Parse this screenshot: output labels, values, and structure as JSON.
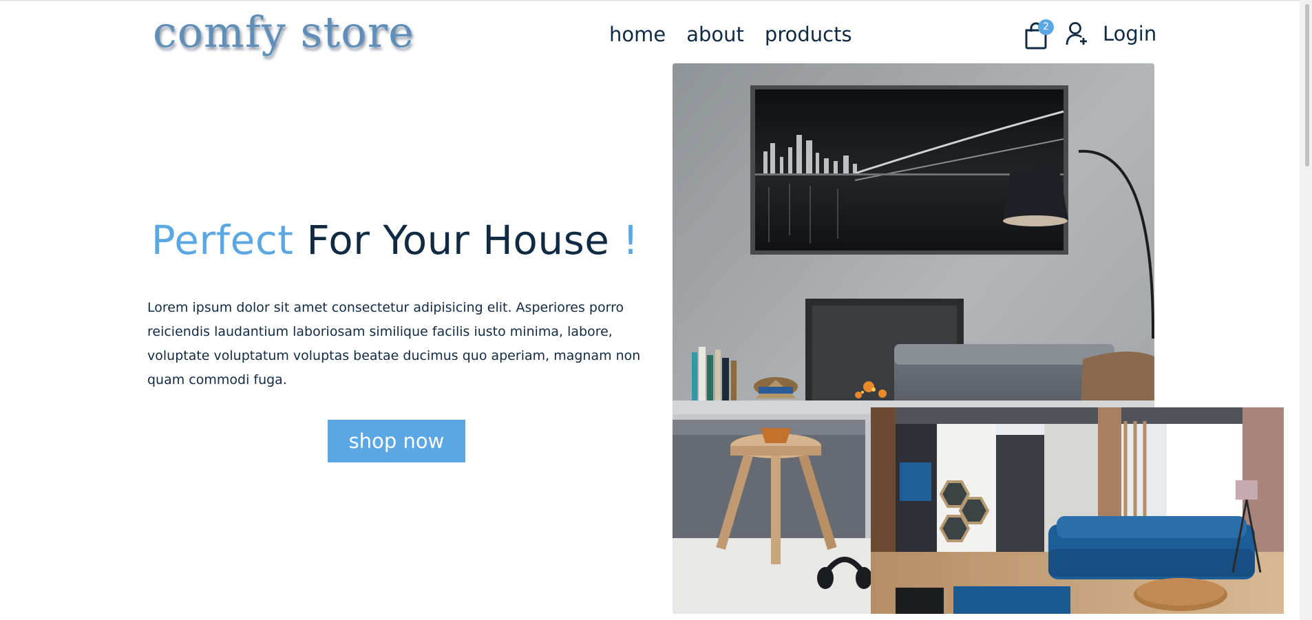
{
  "header": {
    "logo_text": "comfy store",
    "nav": [
      "home",
      "about",
      "products"
    ],
    "cart_count": "2",
    "login_label": "Login"
  },
  "hero": {
    "title_accent": "Perfect",
    "title_main": "For Your House",
    "title_mark": "!",
    "text": "Lorem ipsum dolor sit amet consectetur adipisicing elit. Asperiores porro reiciendis laudantium laboriosam similique facilis iusto minima, labore, voluptate voluptatum voluptas beatae ducimus quo aperiam, magnam non quam commodi fuga.",
    "button_label": "shop now"
  },
  "colors": {
    "accent": "#5ba7e3",
    "text": "#102a43"
  },
  "icons": {
    "cart": "shopping-bag-icon",
    "user": "user-add-icon"
  }
}
